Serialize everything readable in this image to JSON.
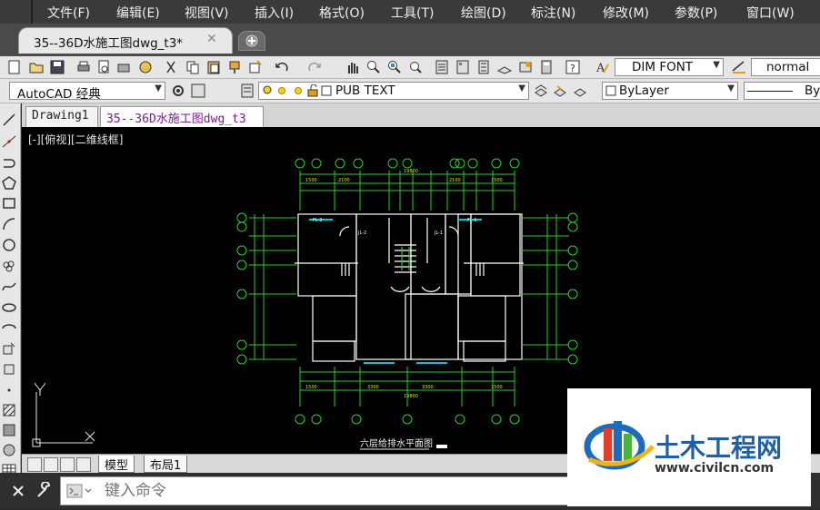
{
  "menu": [
    "文件(F)",
    "编辑(E)",
    "视图(V)",
    "插入(I)",
    "格式(O)",
    "工具(T)",
    "绘图(D)",
    "标注(N)",
    "修改(M)",
    "参数(P)",
    "窗口(W)"
  ],
  "doc_tab": {
    "title": "35--36D水施工图dwg_t3*",
    "close": "✕"
  },
  "toolbar": {
    "dimstyle": "DIM FONT",
    "textstyle": "normal"
  },
  "workspace": "AutoCAD 经典",
  "layer": "PUB TEXT",
  "color": "ByLayer",
  "linetype": "By",
  "file_tabs": [
    "Drawing1",
    "35--36D水施工图dwg_t3"
  ],
  "viewport_label": "[-][俯视][二维线框]",
  "drawing": {
    "title": "六层给排水平面图",
    "top_axes": [
      "1",
      "2",
      "3",
      "4",
      "5",
      "6",
      "7",
      "9",
      "10",
      "11",
      "12",
      "13"
    ],
    "bottom_axes": [
      "1",
      "2",
      "4",
      "7",
      "10",
      "12",
      "13"
    ],
    "side_axes": [
      "H",
      "G",
      "F",
      "E",
      "D",
      "C",
      "B",
      "A"
    ],
    "top_total": "19800",
    "bottom_total": "19800",
    "pipe_labels": [
      "FL-2",
      "FL-1",
      "JL-2",
      "JL-1"
    ]
  },
  "ucs": {
    "x": "X",
    "y": "Y"
  },
  "layout_tabs": [
    "模型",
    "布局1"
  ],
  "command": {
    "placeholder": "键入命令"
  },
  "watermark": {
    "name": "土木工程网",
    "url": "www.civilcn.com"
  }
}
